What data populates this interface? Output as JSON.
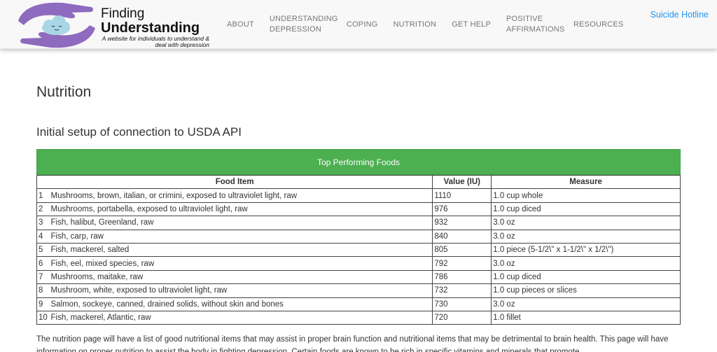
{
  "header": {
    "logo_line1": "Finding",
    "logo_line2": "Understanding",
    "logo_tagline": "A website for individuals to understand & deal with depression",
    "nav": [
      {
        "label": "ABOUT"
      },
      {
        "label": "UNDERSTANDING DEPRESSION"
      },
      {
        "label": "COPING"
      },
      {
        "label": "NUTRITION"
      },
      {
        "label": "GET HELP"
      },
      {
        "label": "POSITIVE AFFIRMATIONS"
      },
      {
        "label": "RESOURCES"
      }
    ],
    "hotline": "Suicide Hotline"
  },
  "main": {
    "title": "Nutrition",
    "subtitle": "Initial setup of connection to USDA API",
    "table": {
      "caption": "Top Performing Foods",
      "columns": [
        "Food Item",
        "Value (IU)",
        "Measure"
      ],
      "rows": [
        {
          "n": "1",
          "food": "Mushrooms, brown, italian, or crimini, exposed to ultraviolet light, raw",
          "value": "1110",
          "measure": "1.0 cup whole"
        },
        {
          "n": "2",
          "food": "Mushrooms, portabella, exposed to ultraviolet light, raw",
          "value": "976",
          "measure": "1.0 cup diced"
        },
        {
          "n": "3",
          "food": "Fish, halibut, Greenland, raw",
          "value": "932",
          "measure": "3.0 oz"
        },
        {
          "n": "4",
          "food": "Fish, carp, raw",
          "value": "840",
          "measure": "3.0 oz"
        },
        {
          "n": "5",
          "food": "Fish, mackerel, salted",
          "value": "805",
          "measure": "1.0 piece (5-1/2\\\" x 1-1/2\\\" x 1/2\\\")"
        },
        {
          "n": "6",
          "food": "Fish, eel, mixed species, raw",
          "value": "792",
          "measure": "3.0 oz"
        },
        {
          "n": "7",
          "food": "Mushrooms, maitake, raw",
          "value": "786",
          "measure": "1.0 cup diced"
        },
        {
          "n": "8",
          "food": "Mushroom, white, exposed to ultraviolet light, raw",
          "value": "732",
          "measure": "1.0 cup pieces or slices"
        },
        {
          "n": "9",
          "food": "Salmon, sockeye, canned, drained solids, without skin and bones",
          "value": "730",
          "measure": "3.0 oz"
        },
        {
          "n": "10",
          "food": "Fish, mackerel, Atlantic, raw",
          "value": "720",
          "measure": "1.0 fillet"
        }
      ]
    },
    "paragraph": "The nutrition page will have a list of good nutritional items that may assist in proper brain function and nutritional items that may be detrimental to brain health. This page will have information on proper nutrition to assist the body in fighting depression. Certain foods are known to be rich in specific vitamins and minerals that promote"
  },
  "colors": {
    "accent_green": "#4caf50",
    "link_blue": "#2196f3",
    "logo_purple": "#8e6bbf",
    "logo_cloud": "#a9d6e5"
  }
}
